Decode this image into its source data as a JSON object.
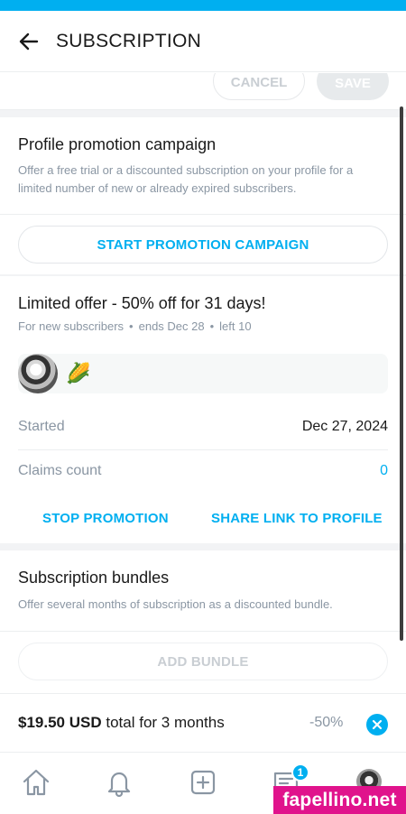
{
  "header": {
    "title": "SUBSCRIPTION"
  },
  "actions": {
    "cancel": "CANCEL",
    "save": "SAVE"
  },
  "promo": {
    "title": "Profile promotion campaign",
    "description": "Offer a free trial or a discounted subscription on your profile for a limited number of new or already expired subscribers.",
    "start_button": "START PROMOTION CAMPAIGN"
  },
  "offer": {
    "title": "Limited offer - 50% off for 31 days!",
    "audience": "For new subscribers",
    "ends": "ends Dec 28",
    "left": "left 10",
    "dot": "•",
    "emoji": "🌽",
    "started_label": "Started",
    "started_value": "Dec 27, 2024",
    "claims_label": "Claims count",
    "claims_value": "0",
    "stop_button": "STOP PROMOTION",
    "share_button": "SHARE LINK TO PROFILE"
  },
  "bundles": {
    "title": "Subscription bundles",
    "description": "Offer several months of subscription as a discounted bundle.",
    "add_button": "ADD BUNDLE",
    "item": {
      "price": "$19.50 USD",
      "term": "total for 3 months",
      "discount": "-50%"
    }
  },
  "nav": {
    "items": [
      "home-icon",
      "bell-icon",
      "add-post-icon",
      "messages-icon",
      "profile-avatar"
    ],
    "messages_badge": "1"
  },
  "watermark": "fapellino.net",
  "colors": {
    "accent": "#00aff0",
    "muted": "#8a96a3",
    "watermark": "#e0138c"
  }
}
